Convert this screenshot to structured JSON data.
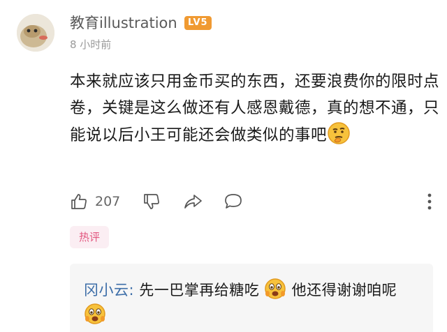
{
  "comment": {
    "username": "教育illustration",
    "level_badge": "LV5",
    "timestamp": "8 小时前",
    "text": "本来就应该只用金币买的东西，还要浪费你的限时点卷，关键是这么做还有人感恩戴德，真的想不通，只能说以后小王可能还会做类似的事吧",
    "emoji": "thinking-face-emoji",
    "like_count": "207",
    "tag": "热评"
  },
  "reply": {
    "author": "冈小云:",
    "text_part1": " 先一巴掌再给糖吃",
    "text_part2": " 他还得谢谢咱呢",
    "emoji": "fearful-face-emoji"
  },
  "colors": {
    "level_badge": "#f09a32",
    "tag_text": "#e2577f",
    "tag_background": "#fbeef3",
    "reply_author": "#3d6ea8",
    "reply_background": "#f6f6f6"
  }
}
